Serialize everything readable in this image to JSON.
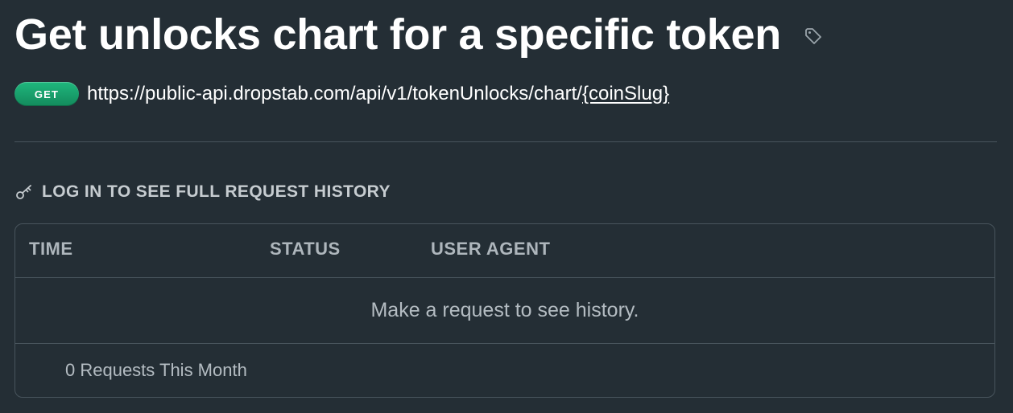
{
  "endpoint": {
    "title": "Get unlocks chart for a specific token",
    "tag_icon": "tag-icon",
    "method": "GET",
    "method_color": "#1a9e6c",
    "url_base": "https://public-api.dropstab.com/api/v1/tokenUnlocks/chart/",
    "url_param": "{coinSlug}"
  },
  "history": {
    "icon": "key-icon",
    "header_label": "LOG IN TO SEE FULL REQUEST HISTORY",
    "columns": [
      "TIME",
      "STATUS",
      "USER AGENT"
    ],
    "empty_message": "Make a request to see history.",
    "requests_summary": "0 Requests This Month"
  },
  "colors": {
    "background": "#242e35",
    "border": "#48545c",
    "muted_text": "#b4bcc2"
  }
}
